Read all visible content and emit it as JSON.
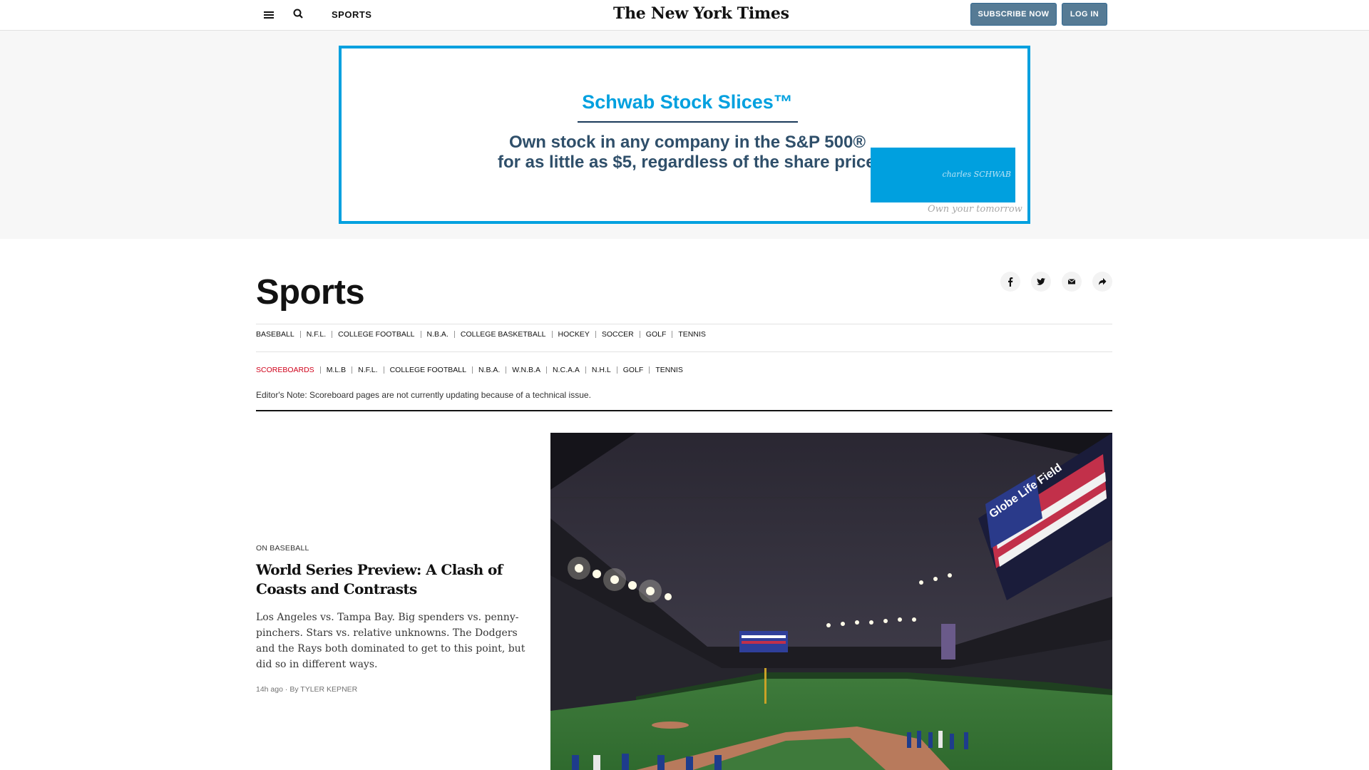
{
  "header": {
    "section_label": "SPORTS",
    "logo_text": "The New York Times",
    "subscribe_label": "SUBSCRIBE NOW",
    "login_label": "LOG IN"
  },
  "ad": {
    "title": "Schwab Stock Slices™",
    "line1": "Own stock in any company in the S&P 500®",
    "line2": "for as little as $5, regardless of the share price",
    "brand": "charles SCHWAB",
    "tagline": "Own your tomorrow"
  },
  "page": {
    "title": "Sports"
  },
  "share_icons": [
    "facebook-icon",
    "twitter-icon",
    "email-icon",
    "share-arrow-icon"
  ],
  "subnav": [
    "BASEBALL",
    "N.F.L.",
    "COLLEGE FOOTBALL",
    "N.B.A.",
    "COLLEGE BASKETBALL",
    "HOCKEY",
    "SOCCER",
    "GOLF",
    "TENNIS"
  ],
  "scorenav": [
    "SCOREBOARDS",
    "M.L.B",
    "N.F.L.",
    "COLLEGE FOOTBALL",
    "N.B.A.",
    "W.N.B.A",
    "N.C.A.A",
    "N.H.L",
    "GOLF",
    "TENNIS"
  ],
  "editor_note": "Editor's Note: Scoreboard pages are not currently updating because of a technical issue.",
  "story": {
    "kicker": "ON BASEBALL",
    "headline": "World Series Preview: A Clash of Coasts and Contrasts",
    "summary": "Los Angeles vs. Tampa Bay. Big spenders vs. penny-pinchers. Stars vs. relative unknowns. The Dodgers and the Rays both dominated to get to this point, but did so in different ways.",
    "time": "14h ago",
    "byline": "By TYLER KEPNER",
    "image_text": "Globe Life Field"
  },
  "colors": {
    "accent": "#567b95",
    "ad_blue": "#00a0df",
    "scoreboard_red": "#d0021b"
  }
}
